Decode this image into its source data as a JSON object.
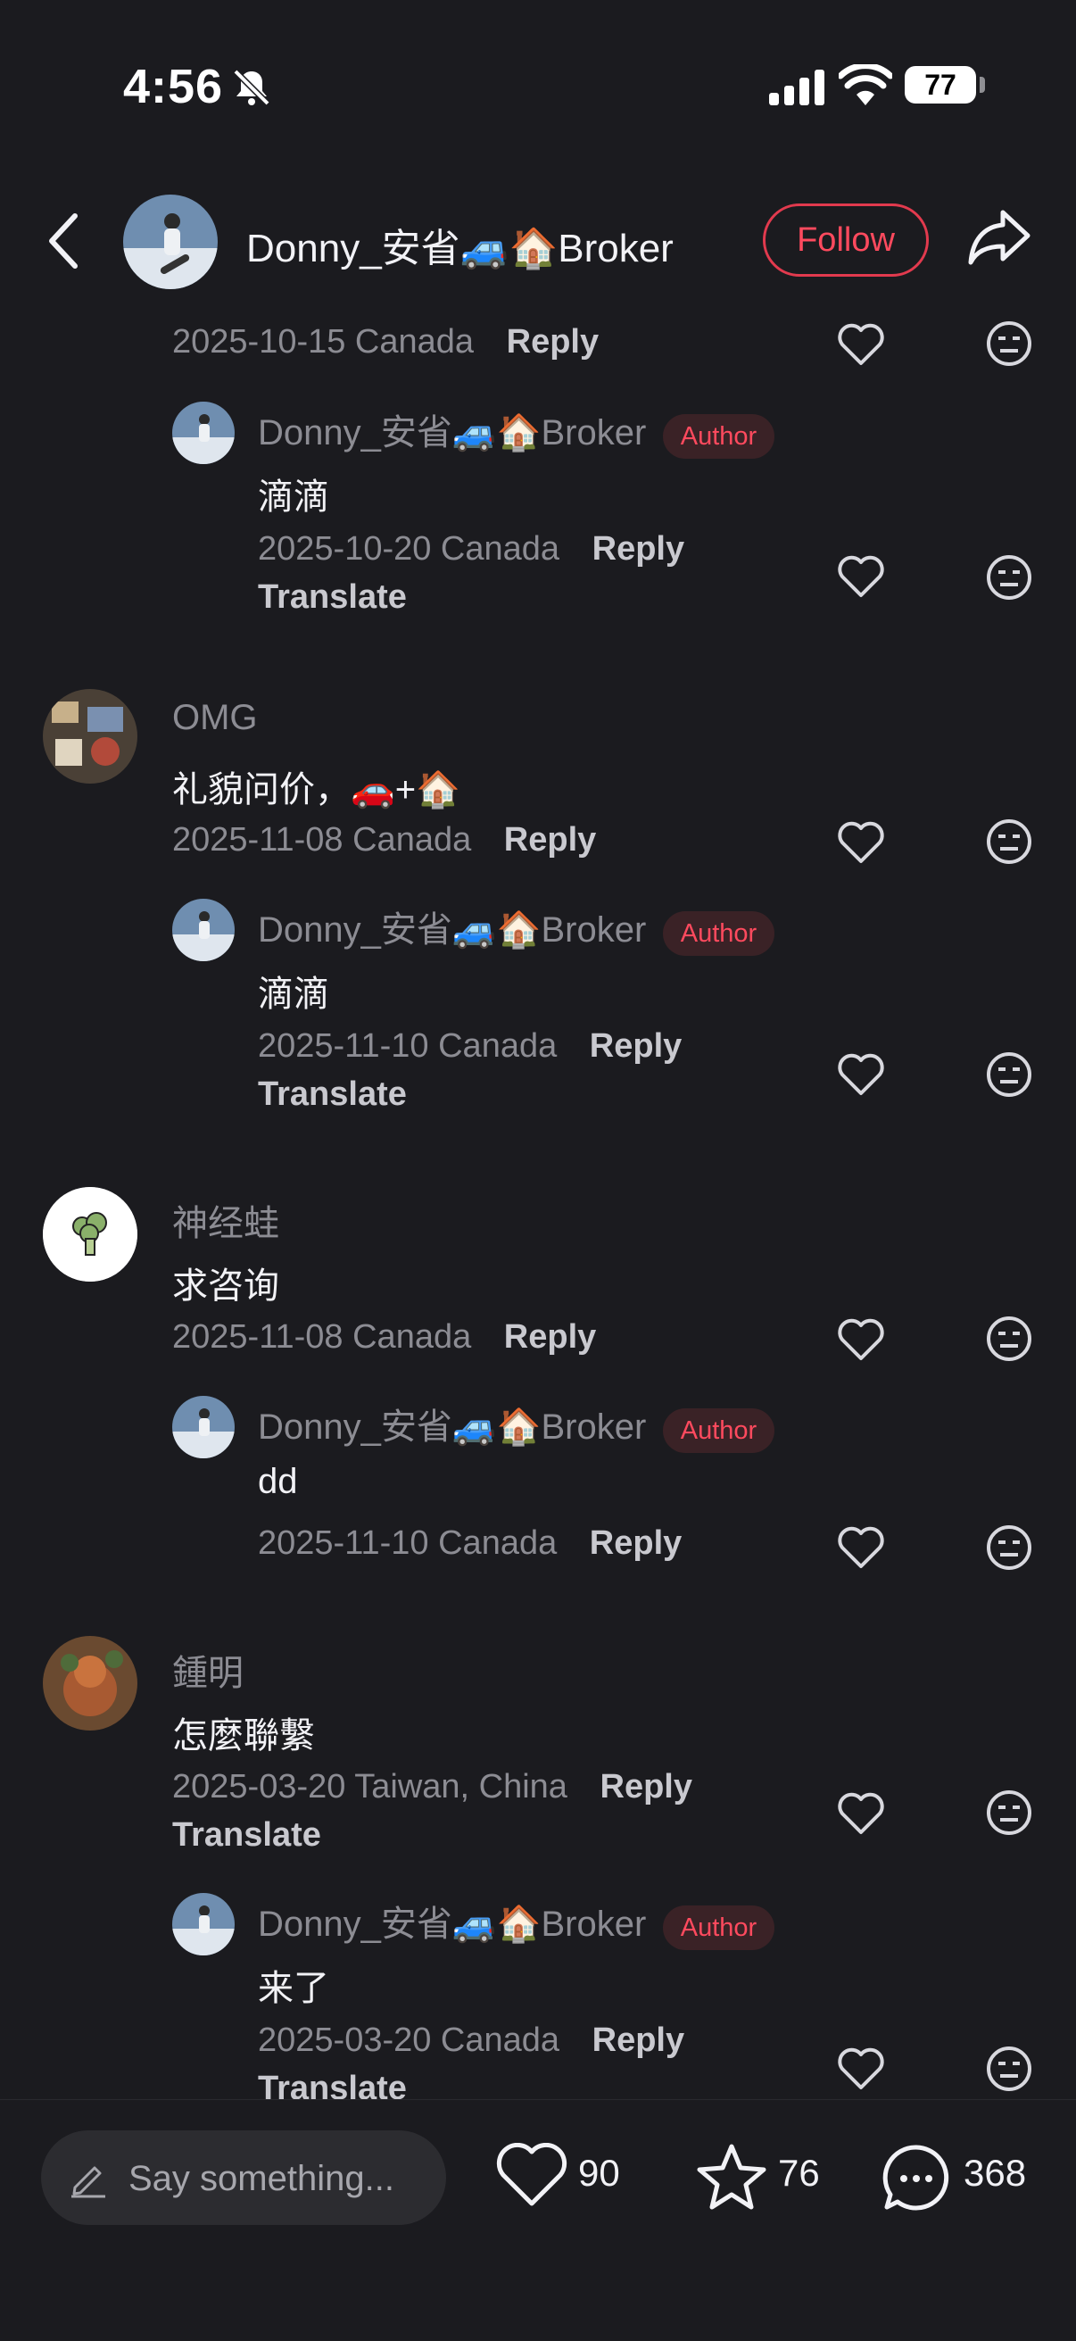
{
  "status_bar": {
    "time": "4:56",
    "battery": "77"
  },
  "header": {
    "username": "Donny_安省🚙🏠Broker",
    "follow_label": "Follow"
  },
  "comments": {
    "c0": {
      "meta": "2025-10-15 Canada",
      "reply": "Reply"
    },
    "c0r": {
      "user": "Donny_安省🚙🏠Broker",
      "badge": "Author",
      "text": "滴滴",
      "meta": "2025-10-20 Canada",
      "reply": "Reply",
      "translate": "Translate"
    },
    "c1": {
      "user": "OMG",
      "text": "礼貌问价，🚗+🏠",
      "meta": "2025-11-08 Canada",
      "reply": "Reply"
    },
    "c1r": {
      "user": "Donny_安省🚙🏠Broker",
      "badge": "Author",
      "text": "滴滴",
      "meta": "2025-11-10 Canada",
      "reply": "Reply",
      "translate": "Translate"
    },
    "c2": {
      "user": "神经蛙",
      "text": "求咨询",
      "meta": "2025-11-08 Canada",
      "reply": "Reply"
    },
    "c2r": {
      "user": "Donny_安省🚙🏠Broker",
      "badge": "Author",
      "text": "dd",
      "meta": "2025-11-10 Canada",
      "reply": "Reply"
    },
    "c3": {
      "user": "鍾明",
      "text": "怎麼聯繫",
      "meta": "2025-03-20 Taiwan, China",
      "reply": "Reply",
      "translate": "Translate"
    },
    "c3r": {
      "user": "Donny_安省🚙🏠Broker",
      "badge": "Author",
      "text": "来了",
      "meta": "2025-03-20 Canada",
      "reply": "Reply",
      "translate": "Translate"
    }
  },
  "bottom_bar": {
    "placeholder": "Say something...",
    "likes": "90",
    "favorites": "76",
    "comments": "368"
  },
  "icons": [
    "back-icon",
    "share-icon",
    "heart-icon",
    "neutral-face-icon",
    "pencil-icon",
    "star-icon",
    "chat-bubble-icon",
    "bell-slash-icon",
    "signal-icon",
    "wifi-icon",
    "broccoli-icon"
  ],
  "colors": {
    "background": "#1b1b1f",
    "accent": "#ff4a5e",
    "badge_bg": "#3a2226",
    "muted_text": "#8c8c93"
  }
}
